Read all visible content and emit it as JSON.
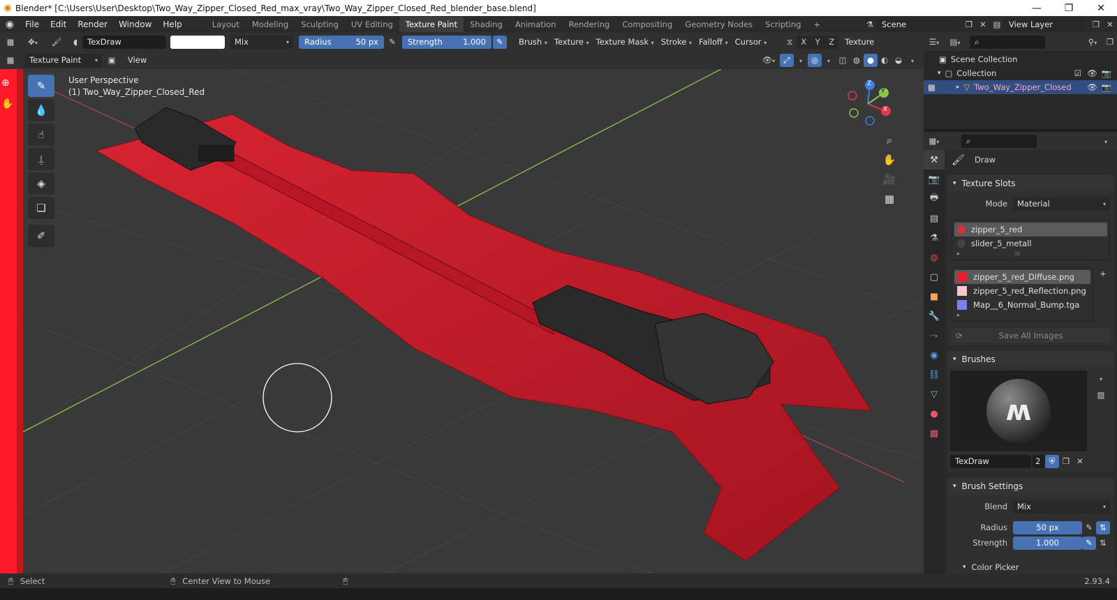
{
  "window": {
    "title": "Blender* [C:\\Users\\User\\Desktop\\Two_Way_Zipper_Closed_Red_max_vray\\Two_Way_Zipper_Closed_Red_blender_base.blend]",
    "minimize": "—",
    "maximize": "❐",
    "close": "✕"
  },
  "menu": [
    "File",
    "Edit",
    "Render",
    "Window",
    "Help"
  ],
  "workspaces": {
    "tabs": [
      "Layout",
      "Modeling",
      "Sculpting",
      "UV Editing",
      "Texture Paint",
      "Shading",
      "Animation",
      "Rendering",
      "Compositing",
      "Geometry Nodes",
      "Scripting"
    ],
    "active": "Texture Paint",
    "add": "+"
  },
  "scene": {
    "name": "Scene",
    "view_layer": "View Layer"
  },
  "tool_header": {
    "brush_name": "TexDraw",
    "blend": "Mix",
    "radius_label": "Radius",
    "radius_value": "50 px",
    "strength_label": "Strength",
    "strength_value": "1.000",
    "menus": [
      "Brush",
      "Texture",
      "Texture Mask",
      "Stroke",
      "Falloff",
      "Cursor"
    ],
    "axes": [
      "X",
      "Y",
      "Z"
    ],
    "texture_label": "Texture"
  },
  "view_header": {
    "mode": "Texture Paint",
    "view": "View"
  },
  "viewport": {
    "perspective": "User Perspective",
    "object": "(1) Two_Way_Zipper_Closed_Red",
    "gizmo_axes": [
      "X",
      "Y",
      "Z"
    ],
    "colors": {
      "x": "#e8374c",
      "y": "#8ac44b",
      "z": "#3d7ee0",
      "zipper": "#c71d2a",
      "slider": "#2a2a2a",
      "grid": "#444444"
    }
  },
  "outliner": {
    "scene_collection": "Scene Collection",
    "collection": "Collection",
    "object": "Two_Way_Zipper_Closed"
  },
  "properties": {
    "tool_name": "Draw",
    "texture_slots": {
      "title": "Texture Slots",
      "mode_label": "Mode",
      "mode_value": "Material",
      "materials": [
        "zipper_5_red",
        "slider_5_metall"
      ],
      "images": [
        "zipper_5_red_Diffuse.png",
        "zipper_5_red_Reflection.png",
        "Map__6_Normal_Bump.tga"
      ],
      "save_all": "Save All Images"
    },
    "brushes": {
      "title": "Brushes",
      "name": "TexDraw",
      "users": "2"
    },
    "brush_settings": {
      "title": "Brush Settings",
      "blend_label": "Blend",
      "blend_value": "Mix",
      "radius_label": "Radius",
      "radius_value": "50 px",
      "strength_label": "Strength",
      "strength_value": "1.000"
    },
    "color_picker": "Color Picker"
  },
  "status": {
    "select": "Select",
    "center": "Center View to Mouse",
    "version": "2.93.4"
  }
}
